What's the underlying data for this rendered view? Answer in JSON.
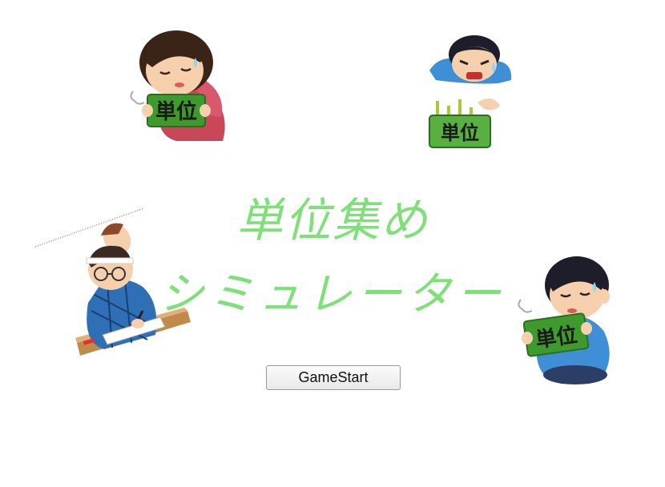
{
  "title": {
    "line1": "単位集め",
    "line2": "シミュレーター"
  },
  "start_button": {
    "label": "GameStart"
  },
  "sign": {
    "text": "単位"
  },
  "colors": {
    "title": "#7fe07a",
    "sign_green": "#3f9a2e",
    "sign_green_light": "#57b040"
  }
}
